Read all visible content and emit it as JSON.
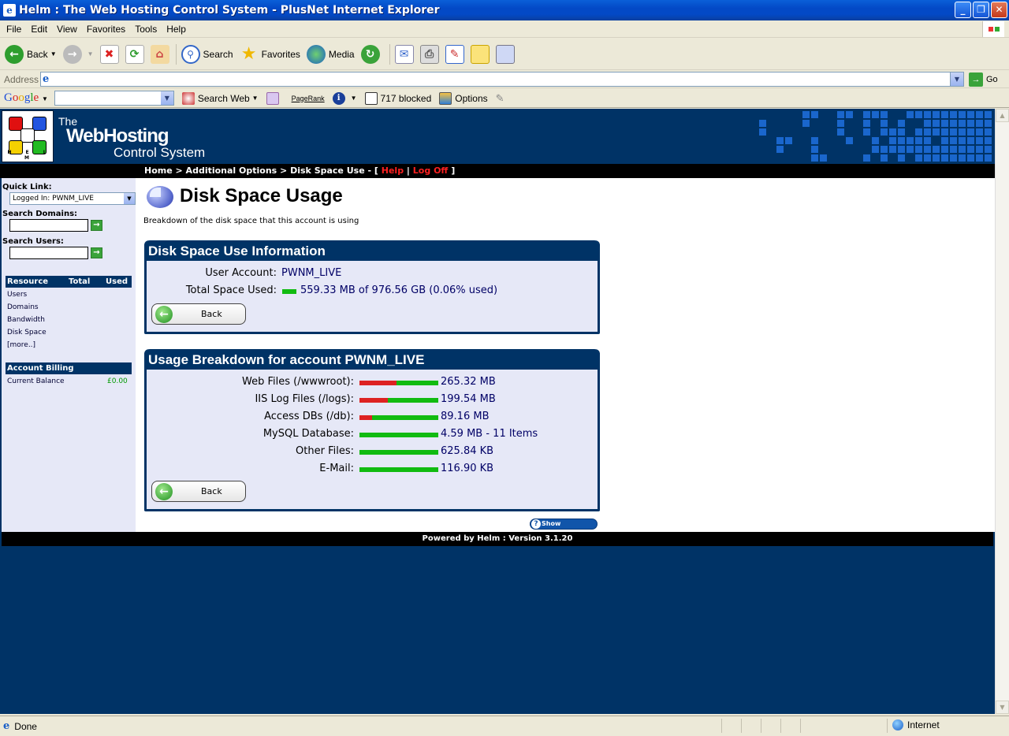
{
  "window": {
    "title": "Helm : The Web Hosting Control System - PlusNet Internet Explorer"
  },
  "menu": [
    "File",
    "Edit",
    "View",
    "Favorites",
    "Tools",
    "Help"
  ],
  "toolbar": {
    "back": "Back",
    "search": "Search",
    "favorites": "Favorites",
    "media": "Media"
  },
  "address": {
    "label": "Address",
    "value": "",
    "go": "Go"
  },
  "google": {
    "search_web": "Search Web",
    "pagerank": "PageRank",
    "blocked": "717 blocked",
    "options": "Options"
  },
  "helm": {
    "logo_text": "H E L M",
    "brand_l1": "The",
    "brand_l2": "WebHosting",
    "brand_l3": "Control System",
    "breadcrumb": "Home > Additional Options > Disk Space Use - [",
    "help": "Help",
    "divider": "|",
    "logoff": "Log Off",
    "bracket_close": "]"
  },
  "sidebar": {
    "quick_link_label": "Quick Link:",
    "quick_link_value": "Logged In: PWNM_LIVE",
    "search_domains_label": "Search Domains:",
    "search_users_label": "Search Users:",
    "resource_header": [
      "Resource",
      "Total",
      "Used"
    ],
    "resources": [
      "Users",
      "Domains",
      "Bandwidth",
      "Disk Space",
      "[more..]"
    ],
    "billing_header": "Account Billing",
    "billing_label": "Current Balance",
    "billing_value": "£0.00"
  },
  "page": {
    "title": "Disk Space Usage",
    "subtitle": "Breakdown of the disk space that this account is using"
  },
  "info_panel": {
    "title": "Disk Space Use Information",
    "user_account_label": "User Account:",
    "user_account_value": "PWNM_LIVE",
    "total_label": "Total Space Used:",
    "total_value": "559.33 MB of 976.56 GB (0.06% used)",
    "back": "Back"
  },
  "breakdown_panel": {
    "title": "Usage Breakdown for account PWNM_LIVE",
    "rows": [
      {
        "label": "Web Files (/wwwroot):",
        "value": "265.32 MB",
        "used_fraction": 0.47
      },
      {
        "label": "IIS Log Files (/logs):",
        "value": "199.54 MB",
        "used_fraction": 0.36
      },
      {
        "label": "Access DBs (/db):",
        "value": "89.16 MB",
        "used_fraction": 0.16
      },
      {
        "label": "MySQL Database:",
        "value": "4.59 MB - 11 Items",
        "used_fraction": 0.0
      },
      {
        "label": "Other Files:",
        "value": "625.84 KB",
        "used_fraction": 0.0
      },
      {
        "label": "E-Mail:",
        "value": "116.90 KB",
        "used_fraction": 0.0
      }
    ],
    "back": "Back"
  },
  "quickhelp": "Show QuickHelp",
  "footer": "Powered by Helm  :  Version 3.1.20",
  "status": {
    "text": "Done",
    "zone": "Internet"
  },
  "colors": {
    "helm_blue": "#003366",
    "bar_used": "#dd2222",
    "bar_free": "#11bb11"
  }
}
